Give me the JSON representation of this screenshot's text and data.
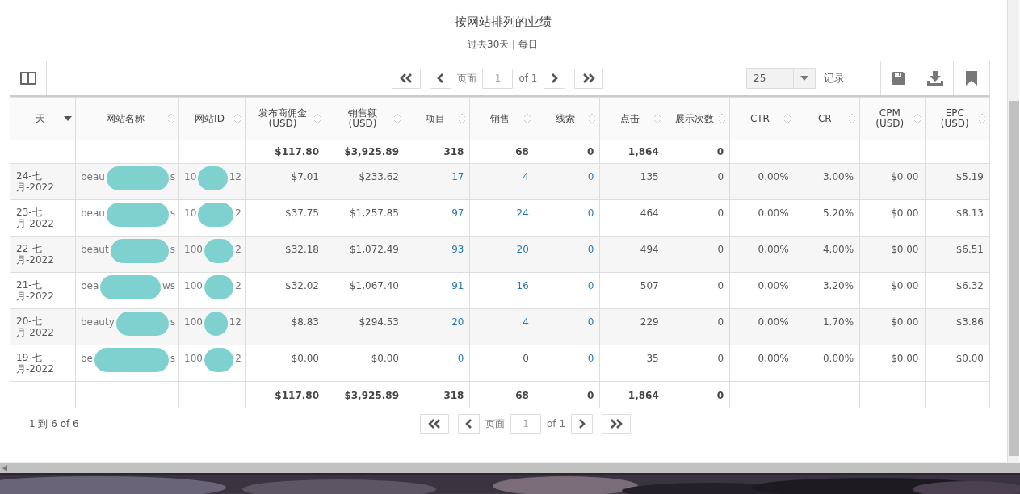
{
  "report": {
    "title": "按网站排列的业绩",
    "subtitle": "过去30天 | 每日"
  },
  "top_pager": {
    "page_label": "页面",
    "page": "1",
    "of": "of 1"
  },
  "page_size": {
    "value": "25",
    "label": "记录"
  },
  "table": {
    "columns": [
      {
        "label": "天",
        "sorted": true
      },
      {
        "label": "网站名称",
        "sorted": false
      },
      {
        "label": "网站ID",
        "sorted": false
      },
      {
        "label": "发布商佣金\n(USD)",
        "sorted": false
      },
      {
        "label": "销售额\n(USD)",
        "sorted": false
      },
      {
        "label": "项目",
        "sorted": false
      },
      {
        "label": "销售",
        "sorted": false
      },
      {
        "label": "线索",
        "sorted": false
      },
      {
        "label": "点击",
        "sorted": false
      },
      {
        "label": "展示次数",
        "sorted": false
      },
      {
        "label": "CTR",
        "sorted": false
      },
      {
        "label": "CR",
        "sorted": false
      },
      {
        "label": "CPM\n(USD)",
        "sorted": false
      },
      {
        "label": "EPC\n(USD)",
        "sorted": false
      }
    ],
    "total_top": {
      "metrics": [
        "$117.80",
        "$3,925.89",
        "318",
        "68",
        "0",
        "1,864",
        "0"
      ]
    },
    "rows": [
      {
        "day": "24-七月-2022",
        "site_name": {
          "start": "beau",
          "end": "s"
        },
        "site_id": {
          "start": "10",
          "end": "12"
        },
        "metrics": [
          "$7.01",
          "$233.62",
          "17",
          "4",
          "0",
          "135",
          "0",
          "0.00%",
          "3.00%",
          "$0.00",
          "$5.19"
        ],
        "links": [
          false,
          false,
          true,
          true,
          true,
          false,
          false,
          false,
          false,
          false,
          false
        ]
      },
      {
        "day": "23-七月-2022",
        "site_name": {
          "start": "beau",
          "end": "s"
        },
        "site_id": {
          "start": "10",
          "end": "2"
        },
        "metrics": [
          "$37.75",
          "$1,257.85",
          "97",
          "24",
          "0",
          "464",
          "0",
          "0.00%",
          "5.20%",
          "$0.00",
          "$8.13"
        ],
        "links": [
          false,
          false,
          true,
          true,
          true,
          false,
          false,
          false,
          false,
          false,
          false
        ]
      },
      {
        "day": "22-七月-2022",
        "site_name": {
          "start": "beaut",
          "end": "s"
        },
        "site_id": {
          "start": "100",
          "end": "2"
        },
        "metrics": [
          "$32.18",
          "$1,072.49",
          "93",
          "20",
          "0",
          "494",
          "0",
          "0.00%",
          "4.00%",
          "$0.00",
          "$6.51"
        ],
        "links": [
          false,
          false,
          true,
          true,
          true,
          false,
          false,
          false,
          false,
          false,
          false
        ]
      },
      {
        "day": "21-七月-2022",
        "site_name": {
          "start": "bea",
          "end": "ws"
        },
        "site_id": {
          "start": "100",
          "end": "2"
        },
        "metrics": [
          "$32.02",
          "$1,067.40",
          "91",
          "16",
          "0",
          "507",
          "0",
          "0.00%",
          "3.20%",
          "$0.00",
          "$6.32"
        ],
        "links": [
          false,
          false,
          true,
          true,
          true,
          false,
          false,
          false,
          false,
          false,
          false
        ]
      },
      {
        "day": "20-七月-2022",
        "site_name": {
          "start": "beauty",
          "end": "s"
        },
        "site_id": {
          "start": "100",
          "end": "12"
        },
        "metrics": [
          "$8.83",
          "$294.53",
          "20",
          "4",
          "0",
          "229",
          "0",
          "0.00%",
          "1.70%",
          "$0.00",
          "$3.86"
        ],
        "links": [
          false,
          false,
          true,
          true,
          true,
          false,
          false,
          false,
          false,
          false,
          false
        ]
      },
      {
        "day": "19-七月-2022",
        "site_name": {
          "start": "be",
          "end": "s"
        },
        "site_id": {
          "start": "100",
          "end": "2"
        },
        "metrics": [
          "$0.00",
          "$0.00",
          "0",
          "0",
          "0",
          "35",
          "0",
          "0.00%",
          "0.00%",
          "$0.00",
          "$0.00"
        ],
        "links": [
          false,
          false,
          true,
          false,
          true,
          false,
          false,
          false,
          false,
          false,
          false
        ]
      }
    ],
    "total_bottom": {
      "metrics": [
        "$117.80",
        "$3,925.89",
        "318",
        "68",
        "0",
        "1,864",
        "0"
      ]
    }
  },
  "summary": "1 到 6 of 6",
  "bottom_pager": {
    "page_label": "页面",
    "page": "1",
    "of": "of 1"
  }
}
